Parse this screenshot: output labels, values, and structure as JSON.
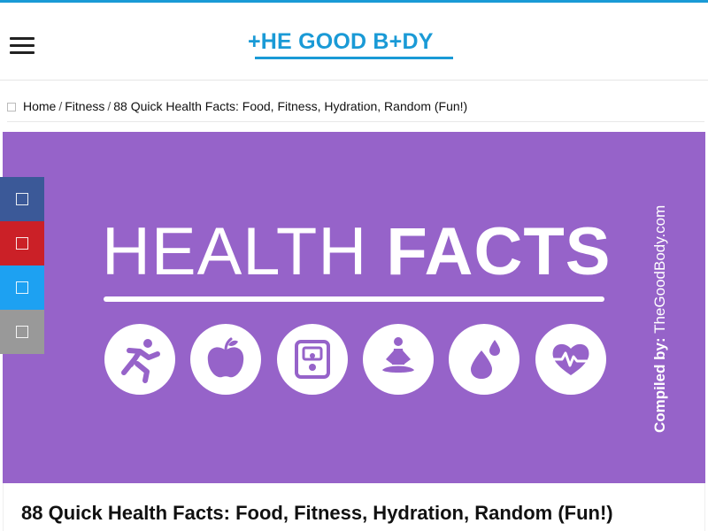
{
  "header": {
    "logo_text": "+HE GOOD B+DY"
  },
  "breadcrumb": {
    "items": [
      "Home",
      "Fitness"
    ],
    "current": "88 Quick Health Facts: Food, Fitness, Hydration, Random (Fun!)",
    "separator": "/"
  },
  "hero": {
    "title_light": "HEALTH",
    "title_bold": "FACTS",
    "background_color": "#9663c9",
    "icons": [
      "runner-icon",
      "apple-icon",
      "scale-icon",
      "meditation-icon",
      "water-drops-icon",
      "heart-rate-icon"
    ],
    "credit_label": "Compiled by:",
    "credit_site": "TheGoodBody.com"
  },
  "share": {
    "buttons": [
      "facebook-icon",
      "pinterest-icon",
      "twitter-icon",
      "email-icon"
    ],
    "colors": [
      "#3b5998",
      "#cb2027",
      "#1da1f2",
      "#999999"
    ]
  },
  "article": {
    "title": "88 Quick Health Facts: Food, Fitness, Hydration, Random (Fun!)"
  },
  "colors": {
    "brand": "#1a9ad6"
  }
}
